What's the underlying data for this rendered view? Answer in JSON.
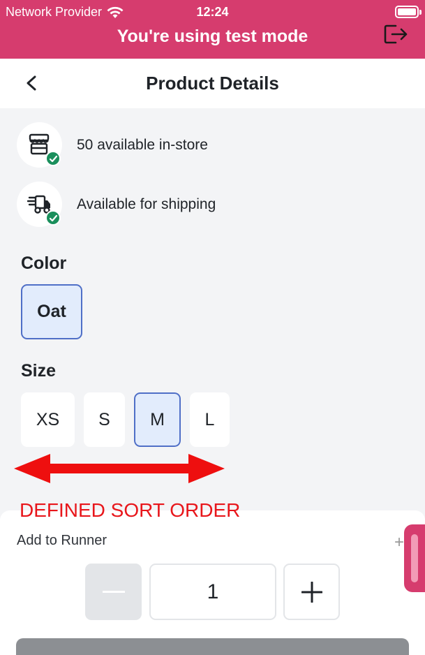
{
  "status_bar": {
    "carrier": "Network Provider",
    "time": "12:24"
  },
  "banner": {
    "text": "You're using test mode"
  },
  "nav": {
    "title": "Product Details"
  },
  "availability": [
    {
      "icon": "store-icon",
      "text": "50 available in-store"
    },
    {
      "icon": "truck-icon",
      "text": "Available for shipping"
    }
  ],
  "color": {
    "label": "Color",
    "options": [
      "Oat"
    ],
    "selected": "Oat"
  },
  "size": {
    "label": "Size",
    "options": [
      "XS",
      "S",
      "M",
      "L"
    ],
    "selected": "M"
  },
  "annotation": {
    "text": "DEFINED SORT ORDER",
    "color": "#e8161b"
  },
  "sheet": {
    "label": "Add to Runner",
    "quantity": "1"
  },
  "colors": {
    "brand": "#d63c6e",
    "success": "#1a8f5c",
    "selected_border": "#4f6fc7"
  }
}
